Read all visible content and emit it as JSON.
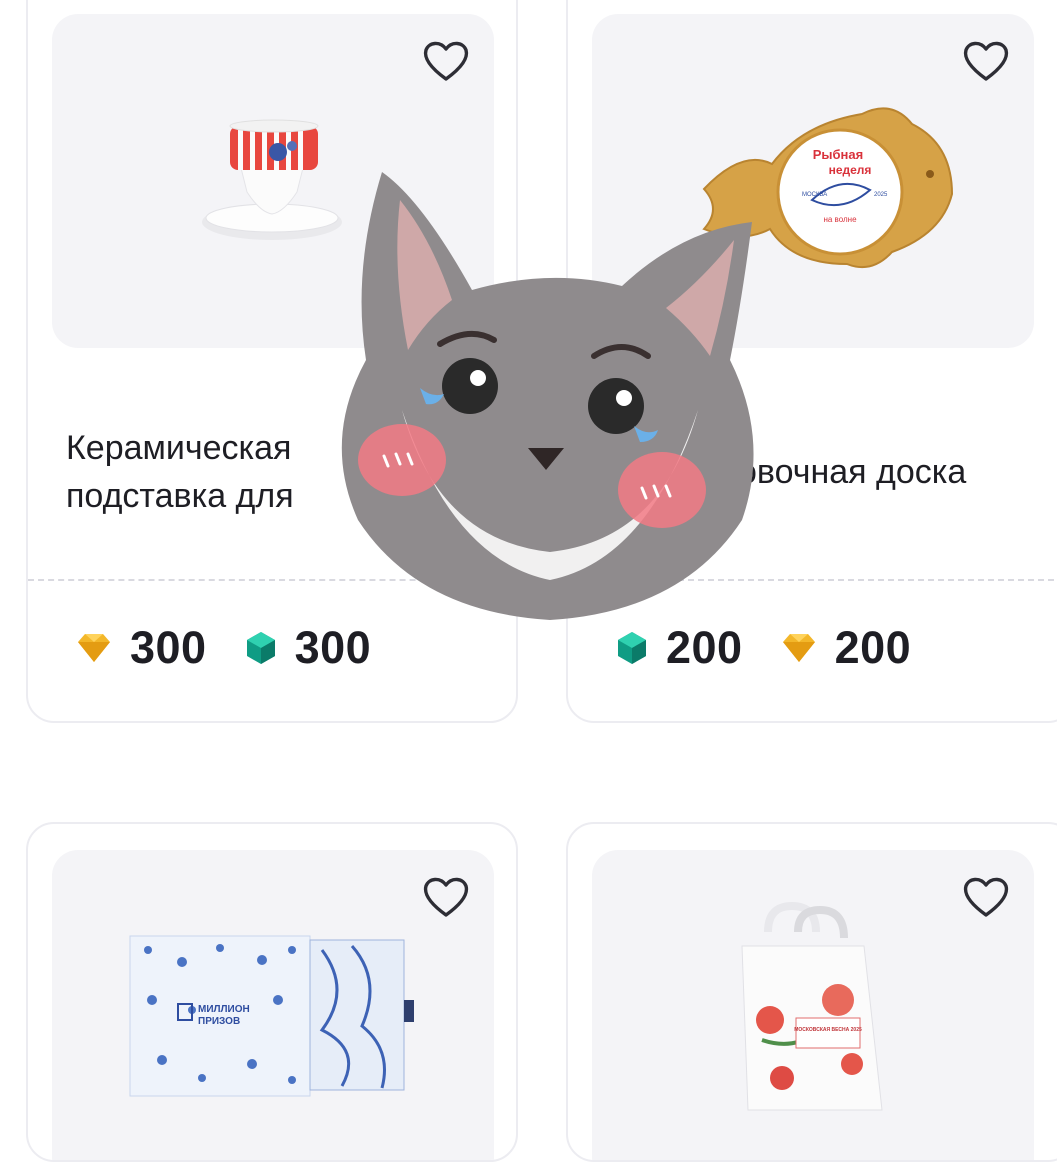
{
  "products": [
    {
      "title": "Керамическая\nподставка для",
      "prices": [
        {
          "currency": "gold-diamond-icon",
          "value": "300"
        },
        {
          "currency": "green-gem-icon",
          "value": "300"
        }
      ]
    },
    {
      "title": "овочная доска",
      "image_text": {
        "line1": "Рыбная",
        "line2": "неделя",
        "line3": "на волне",
        "small_left": "МОСКВА",
        "small_right": "2025"
      },
      "prices": [
        {
          "currency": "green-gem-icon",
          "value": "200"
        },
        {
          "currency": "gold-diamond-icon",
          "value": "200"
        }
      ]
    },
    {
      "box_text": {
        "logo_line1": "МИЛЛИОН",
        "logo_line2": "ПРИЗОВ"
      }
    },
    {
      "bag_text": "МОСКОВСКАЯ ВЕСНА 2025"
    }
  ],
  "colors": {
    "accent_gold": "#f0b323",
    "accent_green": "#12a38a",
    "card_border": "#ececf1",
    "image_bg": "#f4f4f7"
  },
  "sticker": "crying-cat-sticker"
}
